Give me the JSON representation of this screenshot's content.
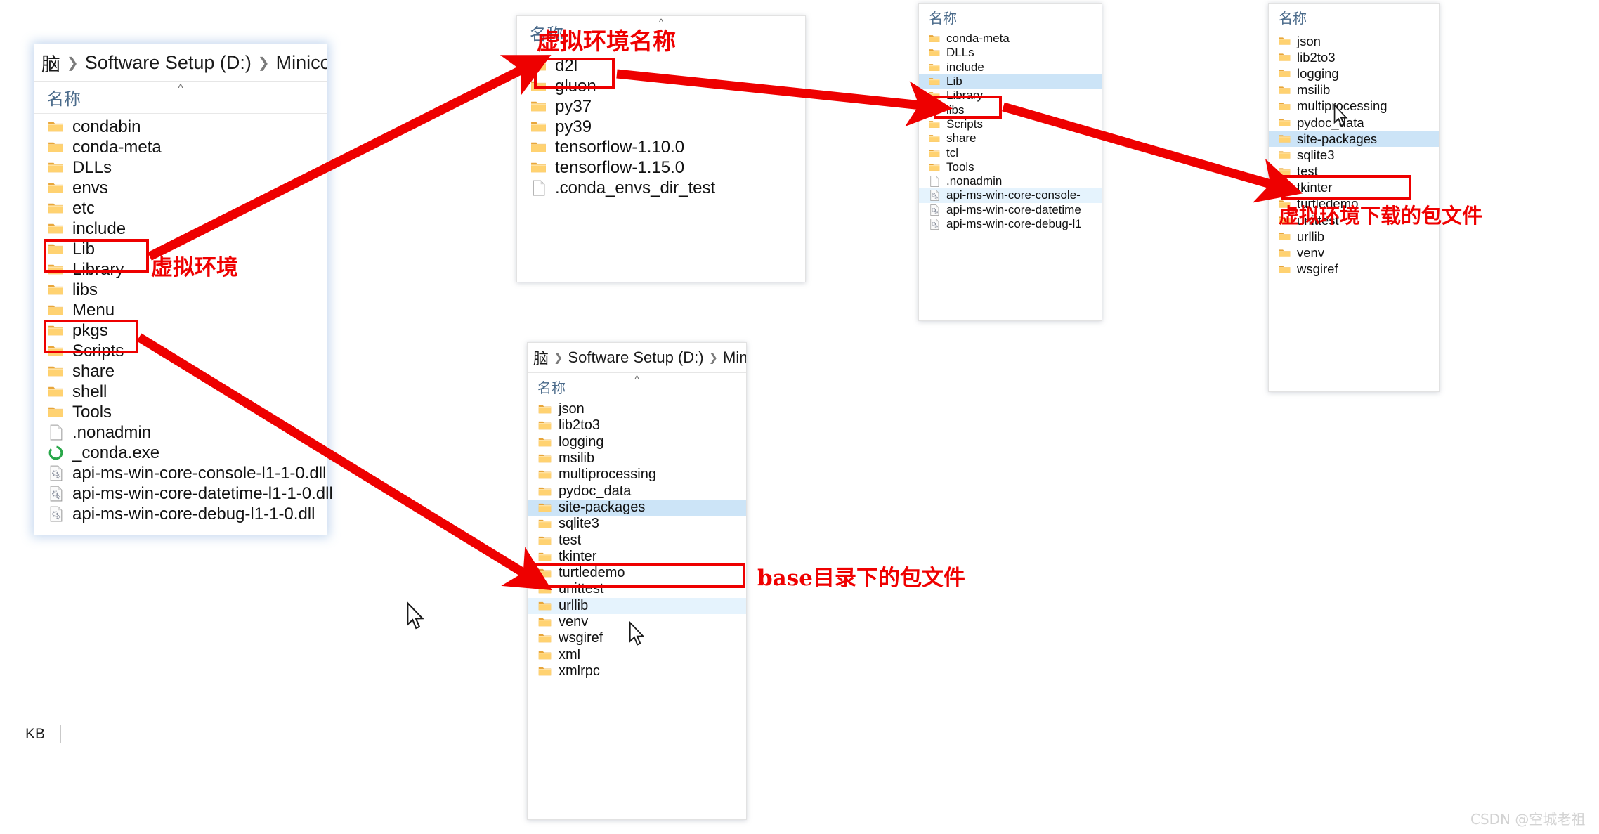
{
  "watermark": "CSDN @空城老祖",
  "windows": {
    "miniconda_root": {
      "name": "miniconda-root-window",
      "breadcrumb": [
        "脑",
        "Software Setup (D:)",
        "Miniconda"
      ],
      "column_header": "名称",
      "status_text": "KB",
      "items": [
        {
          "label": "condabin",
          "icon": "folder-icon",
          "state": "normal"
        },
        {
          "label": "conda-meta",
          "icon": "folder-icon",
          "state": "normal"
        },
        {
          "label": "DLLs",
          "icon": "folder-icon",
          "state": "normal"
        },
        {
          "label": "envs",
          "icon": "folder-icon",
          "state": "normal"
        },
        {
          "label": "etc",
          "icon": "folder-icon",
          "state": "normal"
        },
        {
          "label": "include",
          "icon": "folder-icon",
          "state": "normal"
        },
        {
          "label": "Lib",
          "icon": "folder-icon",
          "state": "normal"
        },
        {
          "label": "Library",
          "icon": "folder-icon",
          "state": "normal"
        },
        {
          "label": "libs",
          "icon": "folder-icon",
          "state": "normal"
        },
        {
          "label": "Menu",
          "icon": "folder-icon",
          "state": "normal"
        },
        {
          "label": "pkgs",
          "icon": "folder-icon",
          "state": "normal"
        },
        {
          "label": "Scripts",
          "icon": "folder-icon",
          "state": "normal"
        },
        {
          "label": "share",
          "icon": "folder-icon",
          "state": "normal"
        },
        {
          "label": "shell",
          "icon": "folder-icon",
          "state": "normal"
        },
        {
          "label": "Tools",
          "icon": "folder-icon",
          "state": "normal"
        },
        {
          "label": ".nonadmin",
          "icon": "blank-file-icon",
          "state": "normal"
        },
        {
          "label": "_conda.exe",
          "icon": "conda-exe-icon",
          "state": "normal"
        },
        {
          "label": "api-ms-win-core-console-l1-1-0.dll",
          "icon": "dll-file-icon",
          "state": "normal"
        },
        {
          "label": "api-ms-win-core-datetime-l1-1-0.dll",
          "icon": "dll-file-icon",
          "state": "normal"
        },
        {
          "label": "api-ms-win-core-debug-l1-1-0.dll",
          "icon": "dll-file-icon",
          "state": "normal"
        }
      ]
    },
    "envs": {
      "name": "envs-window",
      "column_header": "名称",
      "items": [
        {
          "label": "d2l",
          "icon": "folder-icon",
          "state": "normal"
        },
        {
          "label": "gluon",
          "icon": "folder-icon",
          "state": "normal"
        },
        {
          "label": "py37",
          "icon": "folder-icon",
          "state": "normal"
        },
        {
          "label": "py39",
          "icon": "folder-icon",
          "state": "normal"
        },
        {
          "label": "tensorflow-1.10.0",
          "icon": "folder-icon",
          "state": "normal"
        },
        {
          "label": "tensorflow-1.15.0",
          "icon": "folder-icon",
          "state": "normal"
        },
        {
          "label": ".conda_envs_dir_test",
          "icon": "blank-file-icon",
          "state": "normal"
        }
      ]
    },
    "d2l_env": {
      "name": "d2l-env-window",
      "column_header": "名称",
      "items": [
        {
          "label": "conda-meta",
          "icon": "folder-icon",
          "state": "normal"
        },
        {
          "label": "DLLs",
          "icon": "folder-icon",
          "state": "normal"
        },
        {
          "label": "include",
          "icon": "folder-icon",
          "state": "normal"
        },
        {
          "label": "Lib",
          "icon": "folder-icon",
          "state": "selected"
        },
        {
          "label": "Library",
          "icon": "folder-icon",
          "state": "normal"
        },
        {
          "label": "libs",
          "icon": "folder-icon",
          "state": "normal"
        },
        {
          "label": "Scripts",
          "icon": "folder-icon",
          "state": "normal"
        },
        {
          "label": "share",
          "icon": "folder-icon",
          "state": "normal"
        },
        {
          "label": "tcl",
          "icon": "folder-icon",
          "state": "normal"
        },
        {
          "label": "Tools",
          "icon": "folder-icon",
          "state": "normal"
        },
        {
          "label": ".nonadmin",
          "icon": "blank-file-icon",
          "state": "normal"
        },
        {
          "label": "api-ms-win-core-console-",
          "icon": "dll-file-icon",
          "state": "hover"
        },
        {
          "label": "api-ms-win-core-datetime",
          "icon": "dll-file-icon",
          "state": "normal"
        },
        {
          "label": "api-ms-win-core-debug-l1",
          "icon": "dll-file-icon",
          "state": "normal"
        }
      ]
    },
    "env_lib": {
      "name": "env-lib-window",
      "column_header": "名称",
      "items": [
        {
          "label": "json",
          "icon": "folder-icon",
          "state": "normal"
        },
        {
          "label": "lib2to3",
          "icon": "folder-icon",
          "state": "normal"
        },
        {
          "label": "logging",
          "icon": "folder-icon",
          "state": "normal"
        },
        {
          "label": "msilib",
          "icon": "folder-icon",
          "state": "normal"
        },
        {
          "label": "multiprocessing",
          "icon": "folder-icon",
          "state": "normal"
        },
        {
          "label": "pydoc_data",
          "icon": "folder-icon",
          "state": "normal"
        },
        {
          "label": "site-packages",
          "icon": "folder-icon",
          "state": "selected"
        },
        {
          "label": "sqlite3",
          "icon": "folder-icon",
          "state": "normal"
        },
        {
          "label": "test",
          "icon": "folder-icon",
          "state": "normal"
        },
        {
          "label": "tkinter",
          "icon": "folder-icon",
          "state": "normal"
        },
        {
          "label": "turtledemo",
          "icon": "folder-icon",
          "state": "normal"
        },
        {
          "label": "unittest",
          "icon": "folder-icon",
          "state": "normal"
        },
        {
          "label": "urllib",
          "icon": "folder-icon",
          "state": "normal"
        },
        {
          "label": "venv",
          "icon": "folder-icon",
          "state": "normal"
        },
        {
          "label": "wsgiref",
          "icon": "folder-icon",
          "state": "normal"
        }
      ]
    },
    "base_lib": {
      "name": "base-lib-window",
      "breadcrumb": [
        "脑",
        "Software Setup (D:)",
        "Minico"
      ],
      "column_header": "名称",
      "items": [
        {
          "label": "json",
          "icon": "folder-icon",
          "state": "normal"
        },
        {
          "label": "lib2to3",
          "icon": "folder-icon",
          "state": "normal"
        },
        {
          "label": "logging",
          "icon": "folder-icon",
          "state": "normal"
        },
        {
          "label": "msilib",
          "icon": "folder-icon",
          "state": "normal"
        },
        {
          "label": "multiprocessing",
          "icon": "folder-icon",
          "state": "normal"
        },
        {
          "label": "pydoc_data",
          "icon": "folder-icon",
          "state": "normal"
        },
        {
          "label": "site-packages",
          "icon": "folder-icon",
          "state": "selected"
        },
        {
          "label": "sqlite3",
          "icon": "folder-icon",
          "state": "normal"
        },
        {
          "label": "test",
          "icon": "folder-icon",
          "state": "normal"
        },
        {
          "label": "tkinter",
          "icon": "folder-icon",
          "state": "normal"
        },
        {
          "label": "turtledemo",
          "icon": "folder-icon",
          "state": "normal"
        },
        {
          "label": "unittest",
          "icon": "folder-icon",
          "state": "normal"
        },
        {
          "label": "urllib",
          "icon": "folder-icon",
          "state": "hover"
        },
        {
          "label": "venv",
          "icon": "folder-icon",
          "state": "normal"
        },
        {
          "label": "wsgiref",
          "icon": "folder-icon",
          "state": "normal"
        },
        {
          "label": "xml",
          "icon": "folder-icon",
          "state": "normal"
        },
        {
          "label": "xmlrpc",
          "icon": "folder-icon",
          "state": "normal"
        }
      ]
    }
  },
  "annotations": {
    "envs_label": "虚拟环境",
    "env_names_label": "虚拟环境名称",
    "env_packages_label": "虚拟环境下载的包文件",
    "base_packages_label": "base目录下的包文件"
  },
  "colors": {
    "annotation_red": "#ee0000",
    "selection_blue": "#cce4f7",
    "hover_blue": "#e5f3fd",
    "folder_yellow": "#ffd271",
    "header_text": "#4a6a8a"
  }
}
